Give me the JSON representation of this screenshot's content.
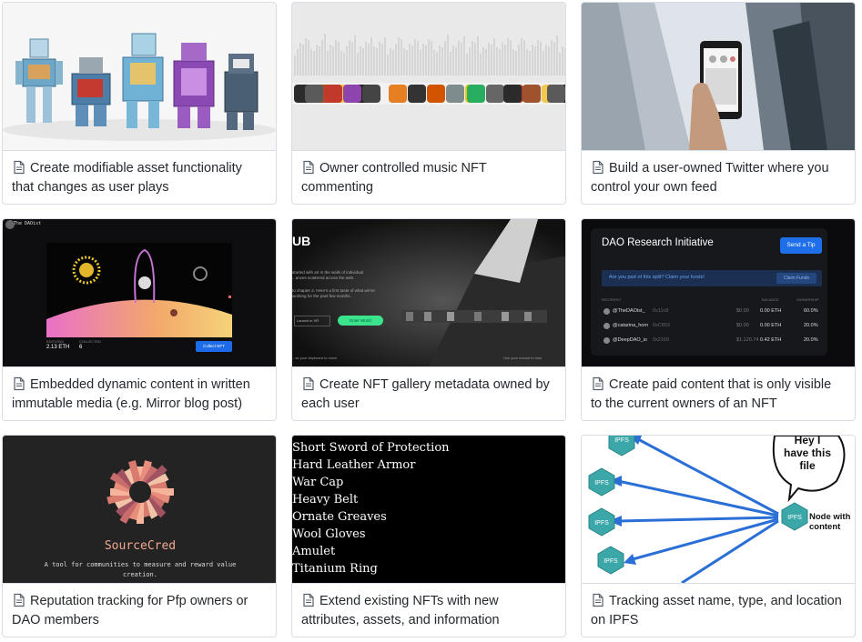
{
  "cards": [
    {
      "title": "Create modifiable asset functionality that changes as user plays"
    },
    {
      "title": "Owner controlled music NFT commenting"
    },
    {
      "title": "Build a user-owned Twitter where you control your own feed"
    },
    {
      "title": "Embedded dynamic content in written immutable media (e.g. Mirror blog post)",
      "thumb": {
        "author": "The DAOist",
        "stat_label_1": "EDITIONS",
        "stat_value_1": "2.13 ETH",
        "stat_label_2": "COLLECTED",
        "stat_value_2": "6",
        "button": "Collect NFT"
      }
    },
    {
      "title": "Create NFT gallery metadata owned by each user",
      "thumb": {
        "heading": "UB",
        "line1": "started with art in the walls of individual",
        "line2": "...ances scattered across the web.",
        "line3": "to chapter 2. Here's a first taste of what we've",
        "line4": "working for the past few months.",
        "input": "Launch in VR",
        "button": "Enter World",
        "foot_left": "...se your keyboard to move",
        "foot_right": "Use your mouse to look"
      }
    },
    {
      "title": "Create paid content that is only visible to the current owners of an NFT",
      "thumb": {
        "heading": "DAO Research Initiative",
        "tip_button": "Send a Tip",
        "banner": "Are you part of this split? Claim your funds!",
        "claim": "Claim Funds",
        "col1": "RECIPIENT",
        "col2": "BALANCE",
        "col3": "OWNERSHIP",
        "rows": [
          {
            "name": "@TheDAOist_",
            "addr": "0x11c8",
            "bal1": "$0.00",
            "bal2": "0.00 ETH",
            "own": "60.0%"
          },
          {
            "name": "@catarina_horn",
            "addr": "0xC853",
            "bal1": "$0.00",
            "bal2": "0.00 ETH",
            "own": "20.0%"
          },
          {
            "name": "@DeepDAO_io",
            "addr": "0x2169",
            "bal1": "$1,120.74",
            "bal2": "0.42 ETH",
            "own": "20.0%"
          }
        ]
      }
    },
    {
      "title": "Reputation tracking for Pfp owners or DAO members",
      "thumb": {
        "brand": "SourceCred",
        "tagline1": "A tool for communities to measure and reward value",
        "tagline2": "creation."
      }
    },
    {
      "title": "Extend existing NFTs with new attributes, assets, and information",
      "thumb": {
        "items": [
          "Short Sword of Protection",
          "Hard Leather Armor",
          "War Cap",
          "Heavy Belt",
          "Ornate Greaves",
          "Wool Gloves",
          "Amulet",
          "Titanium Ring"
        ]
      }
    },
    {
      "title": "Tracking asset name, type, and location on IPFS",
      "thumb": {
        "node_label": "IPFS",
        "bubble": "Hey I have this file",
        "node_caption": "Node with content"
      }
    }
  ],
  "colors": {
    "border": "#d8dee4",
    "text": "#24292f",
    "icon": "#57606a"
  }
}
